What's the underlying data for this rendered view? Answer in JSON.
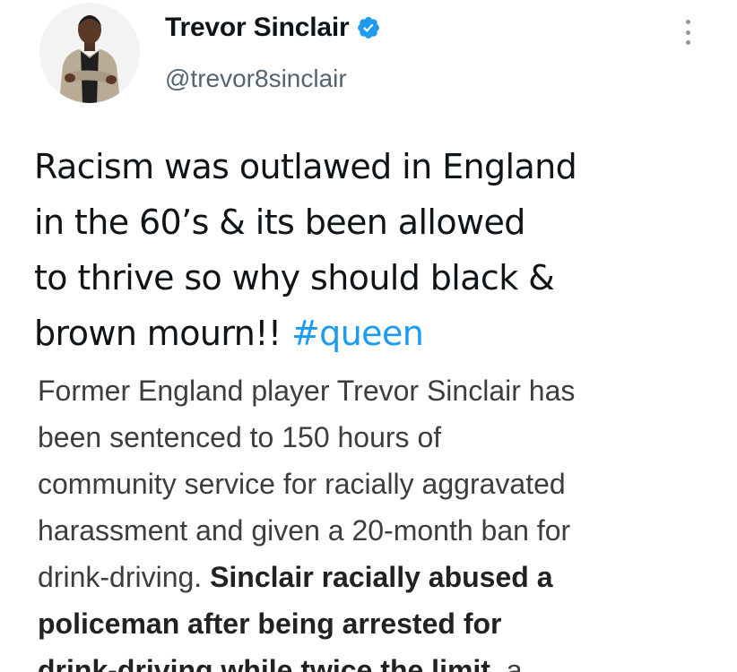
{
  "tweet": {
    "display_name": "Trevor Sinclair",
    "handle": "@trevor8sinclair",
    "verified_icon": "verified-badge-icon",
    "more_icon": "more-options-icon",
    "text_lines": [
      "Racism was outlawed in England",
      "in the 60’s & its been allowed",
      "to thrive so why should black &",
      "brown mourn!! "
    ],
    "hashtag": "#queen"
  },
  "article": {
    "line1": "Former England player Trevor Sinclair has",
    "line2": "been sentenced to 150 hours of",
    "line3": "community service for racially aggravated",
    "line4": "harassment and given a 20-month ban for",
    "line5_plain": "drink-driving. ",
    "line5_bold": "Sinclair racially abused a",
    "line6_bold": "policeman after being arrested for",
    "line7_bold": "drink-driving while twice the limit,",
    "line7_plain": " a"
  },
  "colors": {
    "hashtag": "#1d9bf0",
    "verified": "#1d9bf0",
    "name": "#0f1419",
    "handle": "#536471",
    "article_text": "#3d3d3d"
  }
}
